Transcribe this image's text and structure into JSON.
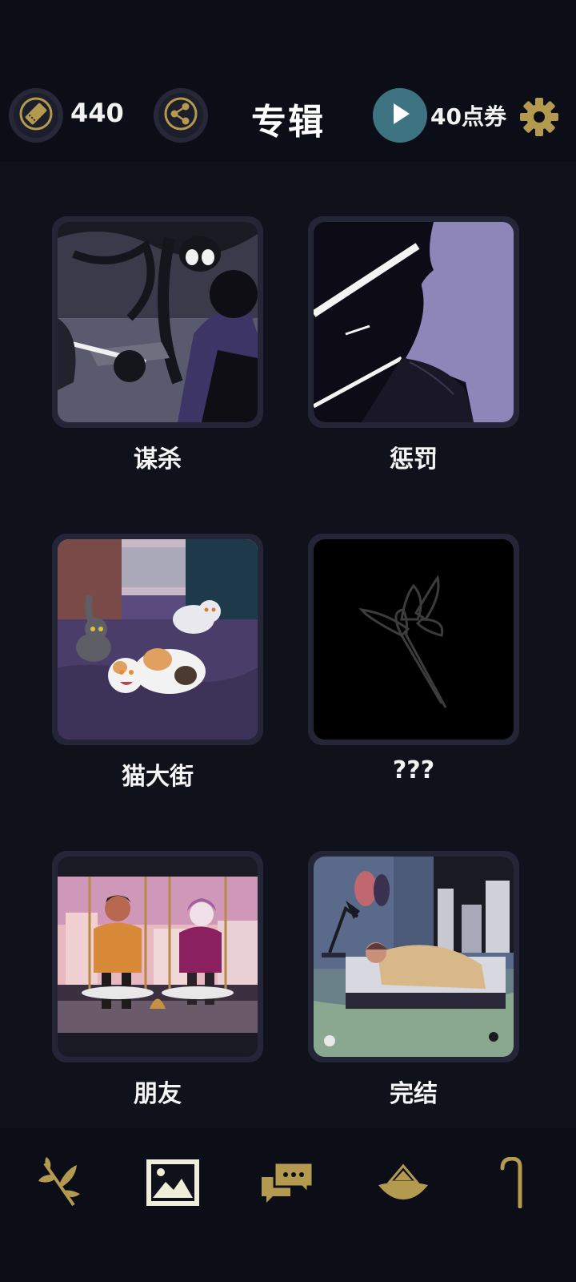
{
  "header": {
    "ticket_count": "440",
    "title": "专辑",
    "points_label": "40点券"
  },
  "albums": [
    {
      "title": "谋杀",
      "locked": false
    },
    {
      "title": "惩罚",
      "locked": false
    },
    {
      "title": "猫大街",
      "locked": false
    },
    {
      "title": "???",
      "locked": true
    },
    {
      "title": "朋友",
      "locked": false
    },
    {
      "title": "完结",
      "locked": false
    }
  ],
  "bottom_nav": {
    "items": [
      {
        "icon": "branch-icon",
        "active": false
      },
      {
        "icon": "gallery-icon",
        "active": true
      },
      {
        "icon": "chat-icon",
        "active": false
      },
      {
        "icon": "hat-icon",
        "active": false
      },
      {
        "icon": "cane-icon",
        "active": false
      }
    ]
  },
  "colors": {
    "background": "#10121b",
    "bar": "#0c0e17",
    "gold": "#b39a4f",
    "card_border": "#242638",
    "play_button": "#3e7382"
  }
}
